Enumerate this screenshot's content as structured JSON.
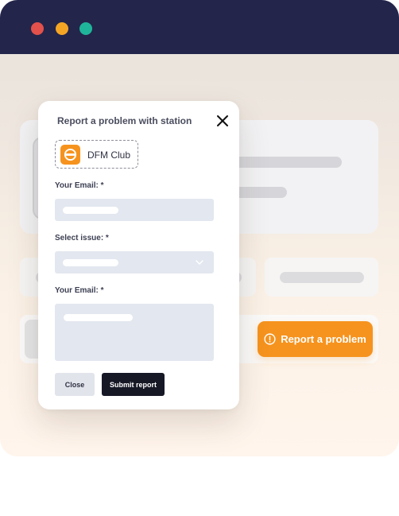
{
  "window": {
    "titlebar_color": "#23254b",
    "traffic_lights": [
      {
        "name": "close",
        "color": "#e2514b"
      },
      {
        "name": "minimize",
        "color": "#f5a524"
      },
      {
        "name": "maximize",
        "color": "#1fb59a"
      }
    ]
  },
  "page": {
    "report_button": {
      "label": "Report a problem",
      "icon": "alert-circle-icon",
      "color": "#f6931e"
    }
  },
  "modal": {
    "title": "Report a problem with station",
    "close_icon": "close-icon",
    "station": {
      "name": "DFM Club",
      "logo_icon": "dfm-club-logo"
    },
    "fields": [
      {
        "label": "Your Email: *",
        "type": "text"
      },
      {
        "label": "Select issue: *",
        "type": "select",
        "icon": "chevron-down-icon"
      },
      {
        "label": "Your Email: *",
        "type": "textarea"
      }
    ],
    "buttons": {
      "close_label": "Close",
      "submit_label": "Submit report"
    }
  }
}
